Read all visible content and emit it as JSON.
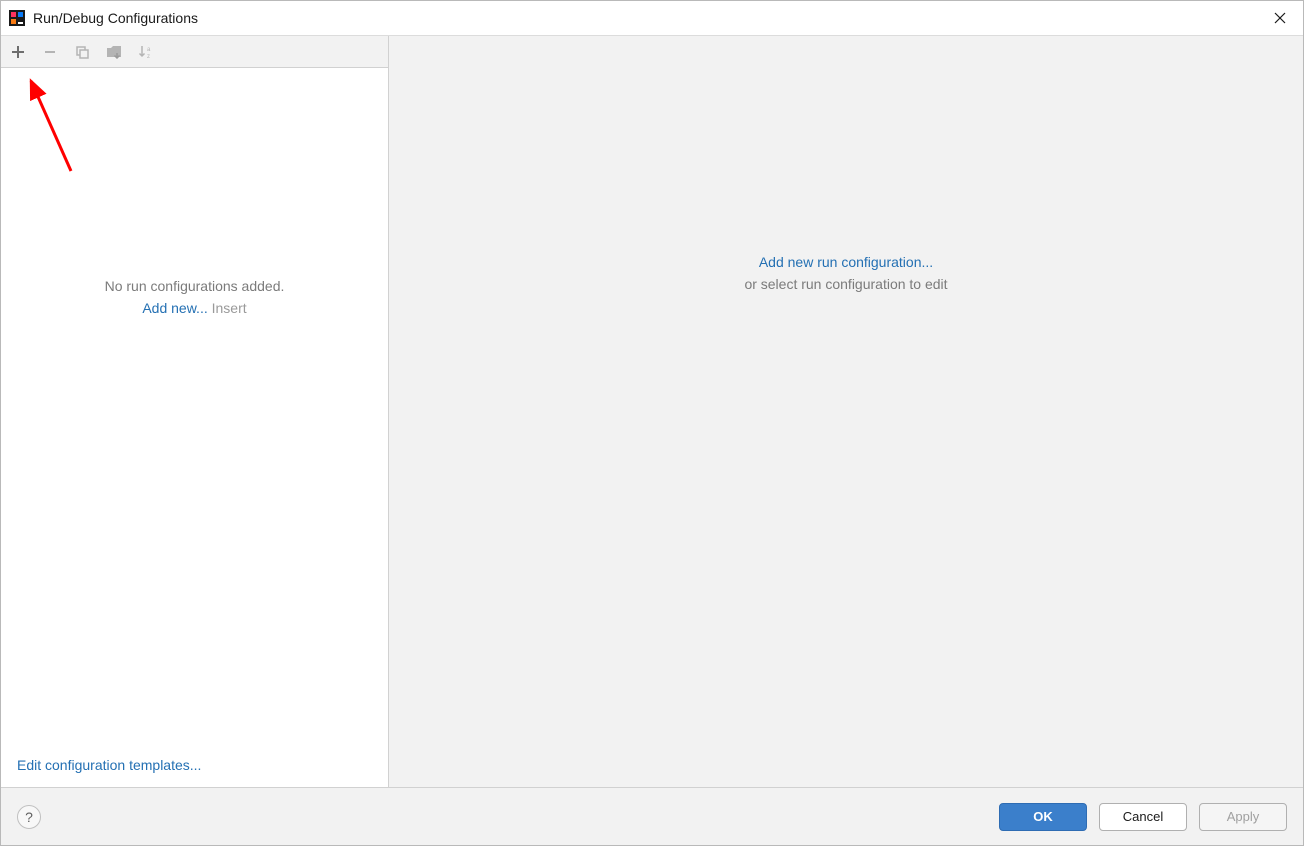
{
  "title_bar": {
    "title": "Run/Debug Configurations"
  },
  "toolbar": {
    "add_tooltip": "Add New Configuration",
    "remove_tooltip": "Remove Configuration",
    "copy_tooltip": "Copy Configuration",
    "save_tooltip": "Save Configuration",
    "sort_tooltip": "Sort Configurations"
  },
  "left_panel": {
    "empty_title": "No run configurations added.",
    "add_link": "Add new...",
    "add_hint": " Insert",
    "templates_link": "Edit configuration templates..."
  },
  "right_panel": {
    "add_link": "Add new run configuration...",
    "sub_text": "or select run configuration to edit"
  },
  "buttons": {
    "ok": "OK",
    "cancel": "Cancel",
    "apply": "Apply"
  }
}
